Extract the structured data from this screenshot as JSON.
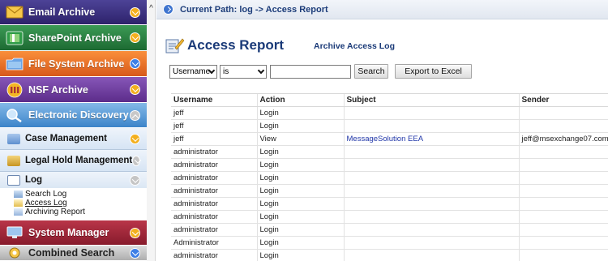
{
  "sidebar": {
    "email_archive": "Email Archive",
    "sharepoint_archive": "SharePoint Archive",
    "file_system_archive": "File System Archive",
    "nsf_archive": "NSF Archive",
    "electronic_discovery": "Electronic Discovery",
    "case_management": "Case Management",
    "legal_hold_management": "Legal Hold Management",
    "log": "Log",
    "log_links": [
      "Search Log",
      "Access Log",
      "Archiving Report"
    ],
    "system_manager": "System Manager",
    "combined_search": "Combined Search"
  },
  "path": {
    "text": "Current Path: log -> Access Report"
  },
  "report": {
    "title": "Access Report",
    "subtitle": "Archive Access Log"
  },
  "filter": {
    "field_value": "Username",
    "operator_value": "is",
    "query_value": "",
    "search_label": "Search",
    "export_label": "Export to Excel"
  },
  "table": {
    "headers": [
      "Username",
      "Action",
      "Subject",
      "Sender"
    ],
    "rows": [
      [
        "jeff",
        "Login",
        "",
        ""
      ],
      [
        "jeff",
        "Login",
        "",
        ""
      ],
      [
        "jeff",
        "View",
        "MessageSolution EEA",
        "jeff@msexchange07.com"
      ],
      [
        "administrator",
        "Login",
        "",
        ""
      ],
      [
        "administrator",
        "Login",
        "",
        ""
      ],
      [
        "administrator",
        "Login",
        "",
        ""
      ],
      [
        "administrator",
        "Login",
        "",
        ""
      ],
      [
        "administrator",
        "Login",
        "",
        ""
      ],
      [
        "administrator",
        "Login",
        "",
        ""
      ],
      [
        "administrator",
        "Login",
        "",
        ""
      ],
      [
        "Administrator",
        "Login",
        "",
        ""
      ],
      [
        "administrator",
        "Login",
        "",
        ""
      ]
    ]
  },
  "colors": {
    "accent_text": "#1a3a78",
    "link": "#2036a8",
    "email_bar": "#3a2f82",
    "sharepoint_bar": "#2b8044",
    "file_system_bar": "#ec7428",
    "nsf_bar": "#743fa3",
    "ediscovery_bar": "#5c9cd9",
    "system_manager_bar": "#a32a3c"
  }
}
